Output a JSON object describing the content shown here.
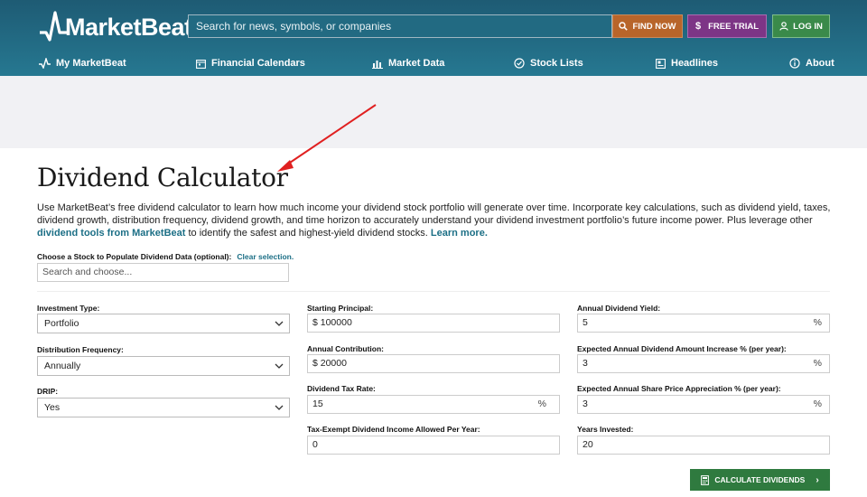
{
  "header": {
    "logo_text": "MarketBeat",
    "search_placeholder": "Search for news, symbols, or companies",
    "find_label": "FIND NOW",
    "trial_label": "FREE TRIAL",
    "login_label": "LOG IN"
  },
  "nav": {
    "items": [
      {
        "label": "My MarketBeat",
        "icon": "pulse-icon"
      },
      {
        "label": "Financial Calendars",
        "icon": "calendar-icon"
      },
      {
        "label": "Market Data",
        "icon": "bar-chart-icon"
      },
      {
        "label": "Stock Lists",
        "icon": "check-circle-icon"
      },
      {
        "label": "Headlines",
        "icon": "newspaper-icon"
      },
      {
        "label": "About",
        "icon": "info-icon"
      }
    ]
  },
  "page": {
    "title": "Dividend Calculator",
    "desc_part1": "Use MarketBeat’s free dividend calculator to learn how much income your dividend stock portfolio will generate over time. Incorporate key calculations, such as dividend yield, taxes, dividend growth, distribution frequency, dividend growth, and time horizon to accurately understand your dividend investment portfolio’s future income power. Plus leverage other ",
    "desc_link1": "dividend tools from MarketBeat",
    "desc_part2": " to identify the safest and highest-yield dividend stocks. ",
    "desc_link2": "Learn more."
  },
  "stock_chooser": {
    "label": "Choose a Stock to Populate Dividend Data (optional):",
    "clear_label": "Clear selection.",
    "placeholder": "Search and choose..."
  },
  "form": {
    "investment_type": {
      "label": "Investment Type:",
      "value": "Portfolio"
    },
    "distribution_frequency": {
      "label": "Distribution Frequency:",
      "value": "Annually"
    },
    "drip": {
      "label": "DRIP:",
      "value": "Yes"
    },
    "starting_principal": {
      "label": "Starting Principal:",
      "value": "$ 100000"
    },
    "annual_contribution": {
      "label": "Annual Contribution:",
      "value": "$ 20000"
    },
    "dividend_tax_rate": {
      "label": "Dividend Tax Rate:",
      "value": "15",
      "suffix": "%"
    },
    "tax_exempt": {
      "label": "Tax-Exempt Dividend Income Allowed Per Year:",
      "value": "0"
    },
    "annual_dividend_yield": {
      "label": "Annual Dividend Yield:",
      "value": "5",
      "suffix": "%"
    },
    "dividend_increase": {
      "label": "Expected Annual Dividend Amount Increase % (per year):",
      "value": "3",
      "suffix": "%"
    },
    "price_appreciation": {
      "label": "Expected Annual Share Price Appreciation % (per year):",
      "value": "3",
      "suffix": "%"
    },
    "years_invested": {
      "label": "Years Invested:",
      "value": "20"
    },
    "calculate_label": "CALCULATE DIVIDENDS"
  },
  "colors": {
    "header": "#226a82",
    "find": "#b8652a",
    "trial": "#7d3586",
    "login": "#3a8a4a",
    "calc": "#2f7a3f",
    "link": "#1c6f86",
    "arrow": "#e02020"
  }
}
